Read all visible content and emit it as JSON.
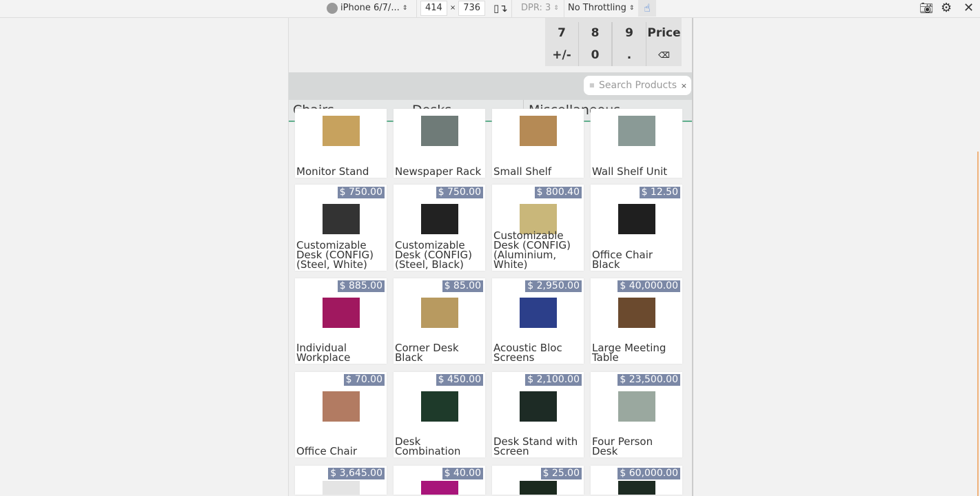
{
  "devtools": {
    "device": "iPhone 6/7/...",
    "width": "414",
    "height": "736",
    "dpr": "DPR: 3",
    "throttling": "No Throttling"
  },
  "numpad": [
    "7",
    "8",
    "9",
    "Price",
    "+/-",
    "0",
    ".",
    "⌫"
  ],
  "search": {
    "placeholder": "Search Products"
  },
  "tabs": [
    "Chairs",
    "Desks",
    "Miscellaneous"
  ],
  "products": [
    {
      "name": "Monitor Stand",
      "price": "",
      "color": "#c7a25e"
    },
    {
      "name": "Newspaper Rack",
      "price": "",
      "color": "#6f7b78"
    },
    {
      "name": "Small Shelf",
      "price": "",
      "color": "#b58a55"
    },
    {
      "name": "Wall Shelf Unit",
      "price": "",
      "color": "#8a9a96"
    },
    {
      "name": "Customizable Desk (CONFIG) (Steel, White)",
      "price": "$ 750.00",
      "color": "#333"
    },
    {
      "name": "Customizable Desk (CONFIG) (Steel, Black)",
      "price": "$ 750.00",
      "color": "#222"
    },
    {
      "name": "Customizable Desk (CONFIG) (Aluminium, White)",
      "price": "$ 800.40",
      "color": "#c9b77a"
    },
    {
      "name": "Office Chair Black",
      "price": "$ 12.50",
      "color": "#1f1f1f"
    },
    {
      "name": "Individual Workplace",
      "price": "$ 885.00",
      "color": "#a0185f"
    },
    {
      "name": "Corner Desk Black",
      "price": "$ 85.00",
      "color": "#b89a60"
    },
    {
      "name": "Acoustic Bloc Screens",
      "price": "$ 2,950.00",
      "color": "#2c3f8a"
    },
    {
      "name": "Large Meeting Table",
      "price": "$ 40,000.00",
      "color": "#6b4a2e"
    },
    {
      "name": "Office Chair",
      "price": "$ 70.00",
      "color": "#b27b62"
    },
    {
      "name": "Desk Combination",
      "price": "$ 450.00",
      "color": "#1e3a2a"
    },
    {
      "name": "Desk Stand with Screen",
      "price": "$ 2,100.00",
      "color": "#1d2b25"
    },
    {
      "name": "Four Person Desk",
      "price": "$ 23,500.00",
      "color": "#9aa89f"
    },
    {
      "name": "",
      "price": "$ 3,645.00",
      "color": "#e4e4e4"
    },
    {
      "name": "",
      "price": "$ 40.00",
      "color": "#a8157a"
    },
    {
      "name": "",
      "price": "$ 25.00",
      "color": "#1b2a1f"
    },
    {
      "name": "",
      "price": "$ 60,000.00",
      "color": "#1d2b22"
    }
  ]
}
